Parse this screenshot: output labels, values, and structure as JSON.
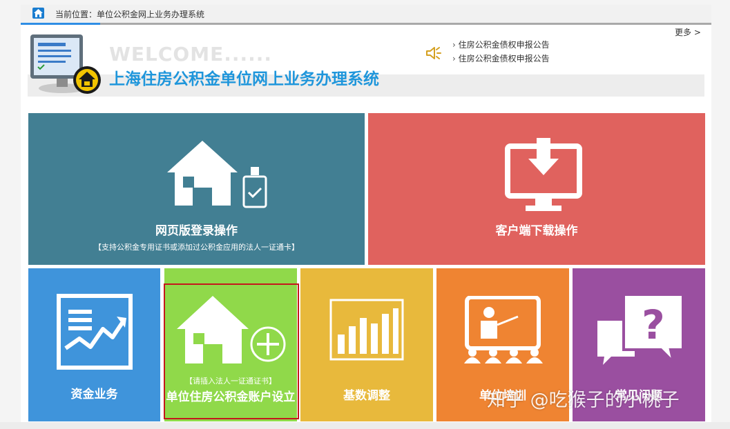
{
  "breadcrumb": {
    "text": "当前位置：单位公积金网上业务办理系统"
  },
  "banner": {
    "welcome": "WELCOME......",
    "system_title": "上海住房公积金单位网上业务办理系统",
    "more_link": "更多 >",
    "notices": [
      "住房公积金债权申报公告",
      "住房公积金债权申报公告"
    ]
  },
  "tiles": {
    "web_login": {
      "label": "网页版登录操作",
      "sub": "【支持公积金专用证书或添加过公积金应用的法人一证通卡】",
      "color": "#427f93"
    },
    "client_download": {
      "label": "客户端下载操作",
      "color": "#e0625e"
    },
    "funds": {
      "label": "资金业务",
      "color": "#3f94db"
    },
    "open_account": {
      "label": "单位住房公积金账户设立",
      "sub": "【请插入法人一证通证书】",
      "color": "#90d94a"
    },
    "base_adjust": {
      "label": "基数调整",
      "color": "#e8b93c"
    },
    "unit_training": {
      "label": "单位培训",
      "color": "#ef8432"
    },
    "faq": {
      "label": "常见问题",
      "color": "#9a4fa0"
    }
  },
  "watermark": "知乎 @吃猴子的小桃子"
}
